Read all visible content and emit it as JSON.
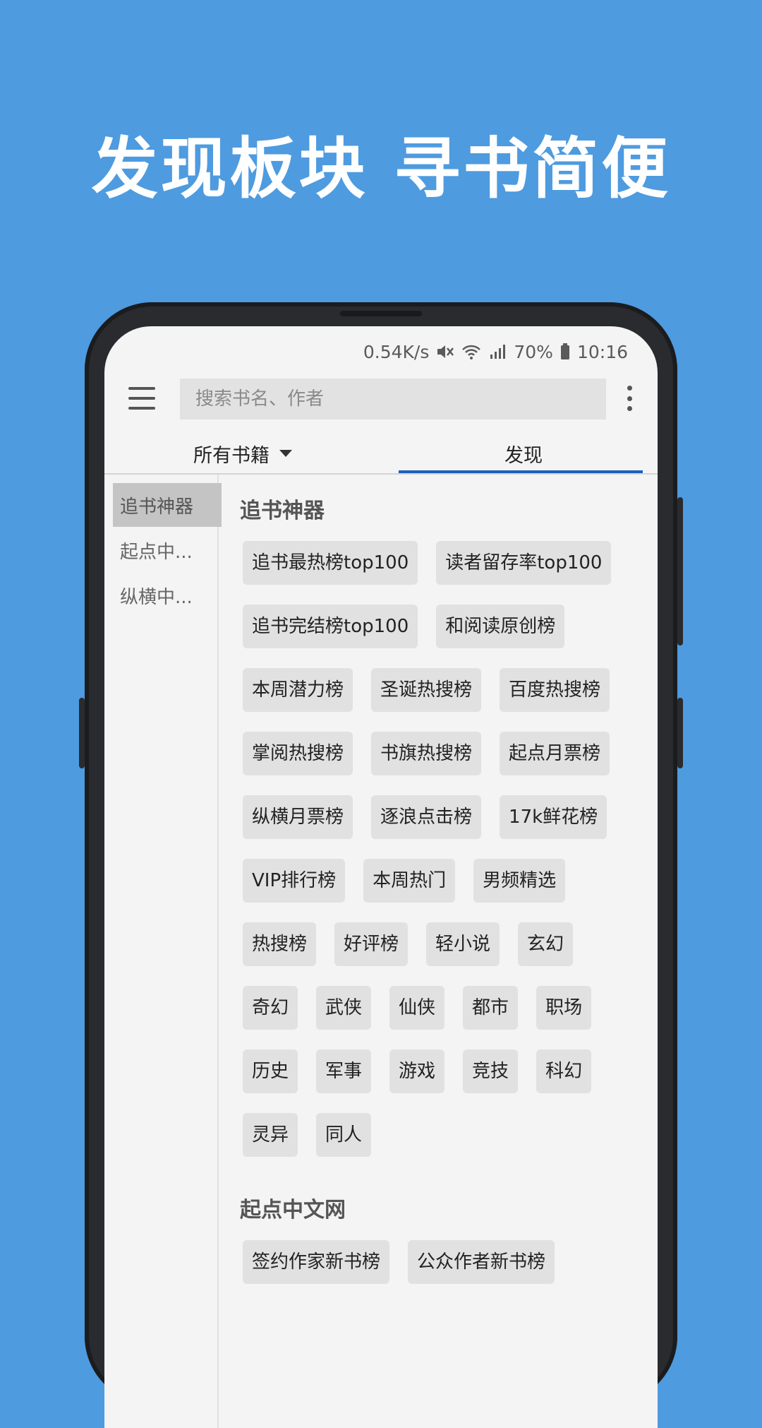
{
  "headline": "发现板块  寻书简便",
  "status_bar": {
    "speed": "0.54K/s",
    "battery": "70%",
    "time": "10:16"
  },
  "toolbar": {
    "search_placeholder": "搜索书名、作者"
  },
  "tabs": [
    {
      "label": "所有书籍"
    },
    {
      "label": "发现"
    }
  ],
  "sidebar": {
    "items": [
      {
        "label": "追书神器"
      },
      {
        "label": "起点中..."
      },
      {
        "label": "纵横中..."
      }
    ]
  },
  "sections": [
    {
      "title": "追书神器",
      "chips": [
        "追书最热榜top100",
        "读者留存率top100",
        "追书完结榜top100",
        "和阅读原创榜",
        "本周潜力榜",
        "圣诞热搜榜",
        "百度热搜榜",
        "掌阅热搜榜",
        "书旗热搜榜",
        "起点月票榜",
        "纵横月票榜",
        "逐浪点击榜",
        "17k鲜花榜",
        "VIP排行榜",
        "本周热门",
        "男频精选",
        "热搜榜",
        "好评榜",
        "轻小说",
        "玄幻",
        "奇幻",
        "武侠",
        "仙侠",
        "都市",
        "职场",
        "历史",
        "军事",
        "游戏",
        "竞技",
        "科幻",
        "灵异",
        "同人"
      ]
    },
    {
      "title": "起点中文网",
      "chips": [
        "签约作家新书榜",
        "公众作者新书榜"
      ]
    }
  ]
}
